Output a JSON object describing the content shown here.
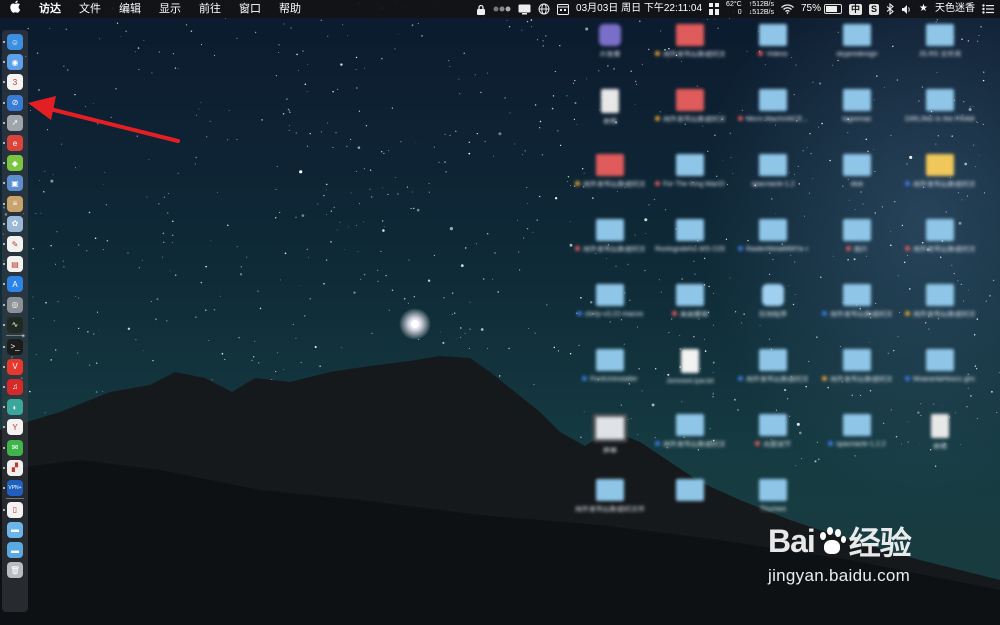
{
  "menubar": {
    "apple": "",
    "app_name": "访达",
    "menus": [
      "文件",
      "编辑",
      "显示",
      "前往",
      "窗口",
      "帮助"
    ],
    "status": {
      "datetime": "03月03日 周日 下午22:11:04",
      "temp_top": "62°C",
      "temp_bottom": "0",
      "net_up": "↑512B/s",
      "net_down": "↓512B/s",
      "battery": "75%",
      "battery_level": 0.75,
      "input_method": "中",
      "user": "天色迷香",
      "star": "★"
    }
  },
  "dock": {
    "items": [
      {
        "name": "finder",
        "color": "#3b8fe0",
        "glyph": "☺"
      },
      {
        "name": "launchpad",
        "color": "#5ba0e8",
        "glyph": "◉"
      },
      {
        "name": "calendar",
        "color": "#f4f4f4",
        "glyph": "3"
      },
      {
        "name": "safari",
        "color": "#3a7bd5",
        "glyph": "⊘"
      },
      {
        "name": "rocket",
        "color": "#a0a4ab",
        "glyph": "➚"
      },
      {
        "name": "app-red",
        "color": "#d9443b",
        "glyph": "e"
      },
      {
        "name": "android",
        "color": "#7cc540",
        "glyph": "◆"
      },
      {
        "name": "preview",
        "color": "#5d8fcf",
        "glyph": "▣"
      },
      {
        "name": "notes",
        "color": "#c8a46c",
        "glyph": "≡"
      },
      {
        "name": "photos",
        "color": "#9ab8d8",
        "glyph": "✿"
      },
      {
        "name": "textedit",
        "color": "#f2f2f2",
        "glyph": "✎"
      },
      {
        "name": "document",
        "color": "#f2f2f2",
        "glyph": "▤"
      },
      {
        "name": "app-store",
        "color": "#2c84e6",
        "glyph": "A"
      },
      {
        "name": "disk-utility",
        "color": "#8c9198",
        "glyph": "◎"
      },
      {
        "name": "activity-monitor",
        "color": "#202a22",
        "glyph": "∿"
      },
      {
        "name": "terminal",
        "color": "#1c1c1c",
        "glyph": ">_"
      },
      {
        "name": "vivaldi",
        "color": "#e5392f",
        "glyph": "V"
      },
      {
        "name": "netease-music",
        "color": "#d42a2a",
        "glyph": "♫"
      },
      {
        "name": "app-teal",
        "color": "#3aa79a",
        "glyph": "◐"
      },
      {
        "name": "yandex",
        "color": "#f2f2f2",
        "glyph": "Y"
      },
      {
        "name": "wechat",
        "color": "#3fb44a",
        "glyph": "✉"
      },
      {
        "name": "app-white",
        "color": "#f0f0f0",
        "glyph": "▞"
      },
      {
        "name": "vpn",
        "color": "#1e5fbf",
        "glyph": "VPN+"
      },
      {
        "name": "file",
        "color": "#f3f3f3",
        "glyph": "▯"
      },
      {
        "name": "folder",
        "color": "#6cb5ea",
        "glyph": "▬"
      },
      {
        "name": "downloads-folder",
        "color": "#5aa9e3",
        "glyph": "▬"
      },
      {
        "name": "trash",
        "color": "#b9bcc0",
        "glyph": "🗑"
      }
    ]
  },
  "desktop": {
    "icons": [
      {
        "label": "开发者",
        "kind": "app",
        "color": "#7a6fc8",
        "tag": ""
      },
      {
        "label": "用外发布后新建的文件夹 4",
        "kind": "folder-red",
        "color": "#e05b5b",
        "tag": "#e8a23a"
      },
      {
        "label": "Videos",
        "kind": "folder",
        "color": "#8fc6e8",
        "tag": "#e05b5b"
      },
      {
        "label": "skypredesign",
        "kind": "folder",
        "color": "#8fc6e8",
        "tag": ""
      },
      {
        "label": "JS.RS 文件夹",
        "kind": "folder",
        "color": "#8fc6e8",
        "tag": ""
      },
      {
        "label": "表格",
        "kind": "doc",
        "color": "#e8e8e8",
        "tag": ""
      },
      {
        "label": "用外发布后新建的文件夹 3",
        "kind": "folder-red",
        "color": "#e05b5b",
        "tag": "#e8a23a"
      },
      {
        "label": "Micro MachiVACE...XMTST",
        "kind": "folder",
        "color": "#8fc6e8",
        "tag": "#e05b5b"
      },
      {
        "label": "tagremac",
        "kind": "folder",
        "color": "#8fc6e8",
        "tag": ""
      },
      {
        "label": "DIRLING In the FRAMES",
        "kind": "folder",
        "color": "#8fc6e8",
        "tag": ""
      },
      {
        "label": "用外发布后新建的文件夹 4",
        "kind": "folder-red",
        "color": "#e05b5b",
        "tag": "#e8a23a"
      },
      {
        "label": "For The King MacOS...XMTST",
        "kind": "folder",
        "color": "#8fc6e8",
        "tag": "#e05b5b"
      },
      {
        "label": "spacriacle-1.2",
        "kind": "folder",
        "color": "#8fc6e8",
        "tag": ""
      },
      {
        "label": "disk",
        "kind": "folder",
        "color": "#8fc6e8",
        "tag": ""
      },
      {
        "label": "用外发布后新建的文件夹 2",
        "kind": "folder-yellow",
        "color": "#f0c75a",
        "tag": "#3b7de0"
      },
      {
        "label": "用外发布后新建的文件夹 14",
        "kind": "folder",
        "color": "#8fc6e8",
        "tag": "#e05b5b"
      },
      {
        "label": "Rootsgrateho.WS CODX-OOO",
        "kind": "folder",
        "color": "#8fc6e8",
        "tag": ""
      },
      {
        "label": "RaiderMetalMMYa sjwt-mc...-vMaker",
        "kind": "folder",
        "color": "#8fc6e8",
        "tag": "#3b7de0"
      },
      {
        "label": "图片",
        "kind": "folder",
        "color": "#8fc6e8",
        "tag": "#e05b5b"
      },
      {
        "label": "用外发布后新建的文件夹 6",
        "kind": "folder",
        "color": "#8fc6e8",
        "tag": "#e05b5b"
      },
      {
        "label": "clinty-v3.22-macos",
        "kind": "folder",
        "color": "#8fc6e8",
        "tag": "#3b7de0"
      },
      {
        "label": "桌面整理",
        "kind": "folder",
        "color": "#8fc6e8",
        "tag": "#e05b5b"
      },
      {
        "label": "应用程序",
        "kind": "app",
        "color": "#9fd0f0",
        "tag": ""
      },
      {
        "label": "用外发布后新建的文件夹 8",
        "kind": "folder",
        "color": "#8fc6e8",
        "tag": "#3b7de0"
      },
      {
        "label": "用外发布后新建的文件夹 9",
        "kind": "folder",
        "color": "#8fc6e8",
        "tag": "#e8a23a"
      },
      {
        "label": "FontUnInstaller",
        "kind": "folder",
        "color": "#8fc6e8",
        "tag": "#3b7de0"
      },
      {
        "label": "Jvmmint.tyw.txt",
        "kind": "doc",
        "color": "#f2f2f2",
        "tag": ""
      },
      {
        "label": "用外发布后新建的文件夹 10",
        "kind": "folder",
        "color": "#8fc6e8",
        "tag": "#3b7de0"
      },
      {
        "label": "用外发布后新建的文件夹 12",
        "kind": "folder",
        "color": "#8fc6e8",
        "tag": "#e8a23a"
      },
      {
        "label": "MoarantaHoscs ghcruz_1.5.8",
        "kind": "folder",
        "color": "#8fc6e8",
        "tag": "#3b7de0"
      },
      {
        "label": "屏幕",
        "kind": "screen",
        "color": "#dfe3e8",
        "tag": ""
      },
      {
        "label": "用外发布后新建的文件夹 11",
        "kind": "folder",
        "color": "#8fc6e8",
        "tag": "#3b7de0"
      },
      {
        "label": "亮度调节",
        "kind": "folder",
        "color": "#8fc6e8",
        "tag": "#e05b5b"
      },
      {
        "label": "spacriacle-1.2.2",
        "kind": "folder",
        "color": "#8fc6e8",
        "tag": "#3b7de0"
      },
      {
        "label": "表格",
        "kind": "doc",
        "color": "#e8e8e8",
        "tag": ""
      },
      {
        "label": "用外发布后新建的文件夹",
        "kind": "folder",
        "color": "#8fc6e8",
        "tag": ""
      },
      {
        "label": "",
        "kind": "folder",
        "color": "#8fc6e8",
        "tag": ""
      },
      {
        "label": "Thumws",
        "kind": "folder",
        "color": "#8fc6e8",
        "tag": ""
      }
    ]
  },
  "watermark": {
    "logo_left": "Bai",
    "logo_right": "经验",
    "site": "jingyan.baidu.com"
  }
}
